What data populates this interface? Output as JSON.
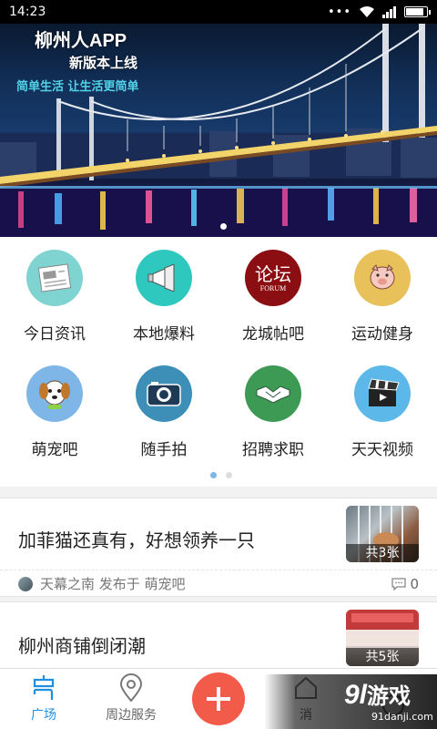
{
  "status_bar": {
    "time": "14:23",
    "dots": "•••"
  },
  "banner": {
    "title": "柳州人APP",
    "subtitle": "新版本上线",
    "slogan": "简单生活  让生活更简单"
  },
  "grid": {
    "items": [
      {
        "label": "今日资讯",
        "icon": "newspaper-icon",
        "color": "#7fd3d0"
      },
      {
        "label": "本地爆料",
        "icon": "megaphone-icon",
        "color": "#2ec8bf"
      },
      {
        "label": "龙城帖吧",
        "icon": "forum-icon",
        "color": "#8b0f12",
        "icon_text": "论坛",
        "icon_subtext": "FORUM"
      },
      {
        "label": "运动健身",
        "icon": "pig-icon",
        "color": "#e8c15a"
      },
      {
        "label": "萌宠吧",
        "icon": "dog-icon",
        "color": "#7fb6e8"
      },
      {
        "label": "随手拍",
        "icon": "camera-icon",
        "color": "#3d8fb8"
      },
      {
        "label": "招聘求职",
        "icon": "handshake-icon",
        "color": "#3d9a55"
      },
      {
        "label": "天天视频",
        "icon": "clapperboard-icon",
        "color": "#5bb8e8"
      }
    ]
  },
  "feed": {
    "posts": [
      {
        "title": "加菲猫还真有，好想领养一只",
        "image_count": "共3张",
        "author_line": "天幕之南 发布于 萌宠吧",
        "comments": "0"
      },
      {
        "title": "柳州商铺倒闭潮",
        "image_count": "共5张"
      }
    ]
  },
  "bottom_nav": {
    "items": [
      {
        "label": "广场",
        "icon": "plaza-icon"
      },
      {
        "label": "周边服务",
        "icon": "location-pin-icon"
      },
      {
        "label": "消",
        "icon": "message-icon"
      }
    ]
  },
  "watermark": {
    "logo": "9l",
    "logo_text": "游戏",
    "url": "91danji.com"
  },
  "colors": {
    "accent": "#1f8fe0",
    "add_button": "#f25b4a",
    "slogan": "#53d3e8"
  }
}
